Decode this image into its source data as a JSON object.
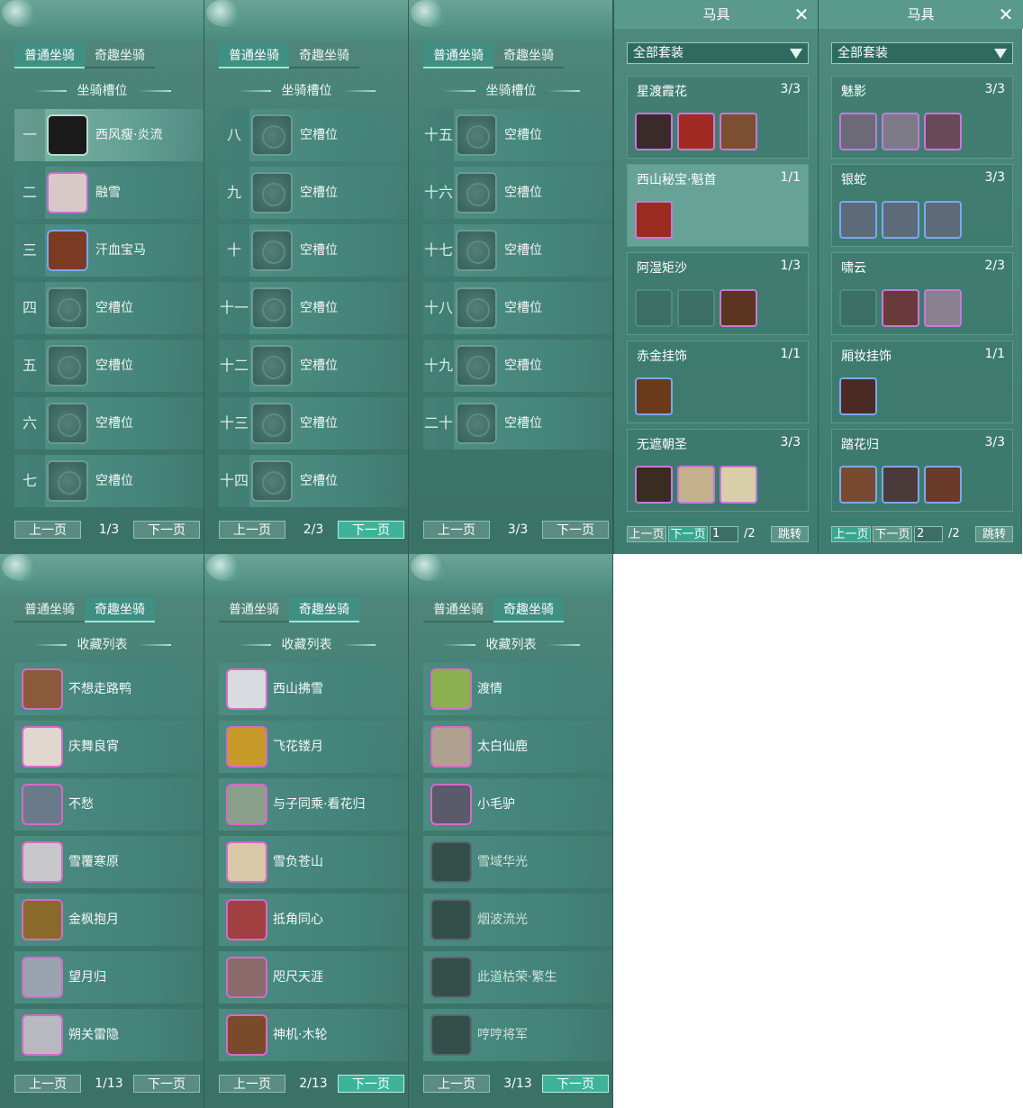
{
  "tabs": {
    "normal": "普通坐骑",
    "fun": "奇趣坐骑"
  },
  "slot_section_title": "坐骑槽位",
  "collection_section_title": "收藏列表",
  "pager": {
    "prev": "上一页",
    "next": "下一页"
  },
  "slot_pages": [
    {
      "page": "1/3",
      "rows": [
        {
          "num": "一",
          "name": "西风瘦·炎流"
        },
        {
          "num": "二",
          "name": "融雪"
        },
        {
          "num": "三",
          "name": "汗血宝马"
        },
        {
          "num": "四",
          "name": "空槽位"
        },
        {
          "num": "五",
          "name": "空槽位"
        },
        {
          "num": "六",
          "name": "空槽位"
        },
        {
          "num": "七",
          "name": "空槽位"
        }
      ]
    },
    {
      "page": "2/3",
      "rows": [
        {
          "num": "八",
          "name": "空槽位"
        },
        {
          "num": "九",
          "name": "空槽位"
        },
        {
          "num": "十",
          "name": "空槽位"
        },
        {
          "num": "十一",
          "name": "空槽位"
        },
        {
          "num": "十二",
          "name": "空槽位"
        },
        {
          "num": "十三",
          "name": "空槽位"
        },
        {
          "num": "十四",
          "name": "空槽位"
        }
      ]
    },
    {
      "page": "3/3",
      "rows": [
        {
          "num": "十五",
          "name": "空槽位"
        },
        {
          "num": "十六",
          "name": "空槽位"
        },
        {
          "num": "十七",
          "name": "空槽位"
        },
        {
          "num": "十八",
          "name": "空槽位"
        },
        {
          "num": "十九",
          "name": "空槽位"
        },
        {
          "num": "二十",
          "name": "空槽位"
        }
      ]
    }
  ],
  "gear_panels": [
    {
      "title": "马具",
      "filter": "全部套装",
      "page_input": "1",
      "page_total": "/2",
      "jump": "跳转",
      "sets": [
        {
          "name": "星渡霞花",
          "count": "3/3"
        },
        {
          "name": "西山秘宝·魁首",
          "count": "1/1"
        },
        {
          "name": "阿湿矩沙",
          "count": "1/3"
        },
        {
          "name": "赤金挂饰",
          "count": "1/1"
        },
        {
          "name": "无遮朝圣",
          "count": "3/3"
        }
      ]
    },
    {
      "title": "马具",
      "filter": "全部套装",
      "page_input": "2",
      "page_total": "/2",
      "jump": "跳转",
      "sets": [
        {
          "name": "魅影",
          "count": "3/3"
        },
        {
          "name": "银蛇",
          "count": "3/3"
        },
        {
          "name": "啸云",
          "count": "2/3"
        },
        {
          "name": "厢妆挂饰",
          "count": "1/1"
        },
        {
          "name": "踏花归",
          "count": "3/3"
        }
      ]
    }
  ],
  "collection_pages": [
    {
      "page": "1/13",
      "items": [
        "不想走路鸭",
        "庆舞良宵",
        "不愁",
        "雪覆寒原",
        "金枫抱月",
        "望月归",
        "朔关雷隐"
      ]
    },
    {
      "page": "2/13",
      "items": [
        "西山拂雪",
        "飞花镂月",
        "与子同乘·看花归",
        "雪负苍山",
        "抵角同心",
        "咫尺天涯",
        "神机·木轮"
      ]
    },
    {
      "page": "3/13",
      "items": [
        "渡情",
        "太白仙鹿",
        "小毛驴",
        "雪域华光",
        "烟波流光",
        "此道枯荣·繁生",
        "哼哼将军"
      ]
    }
  ]
}
